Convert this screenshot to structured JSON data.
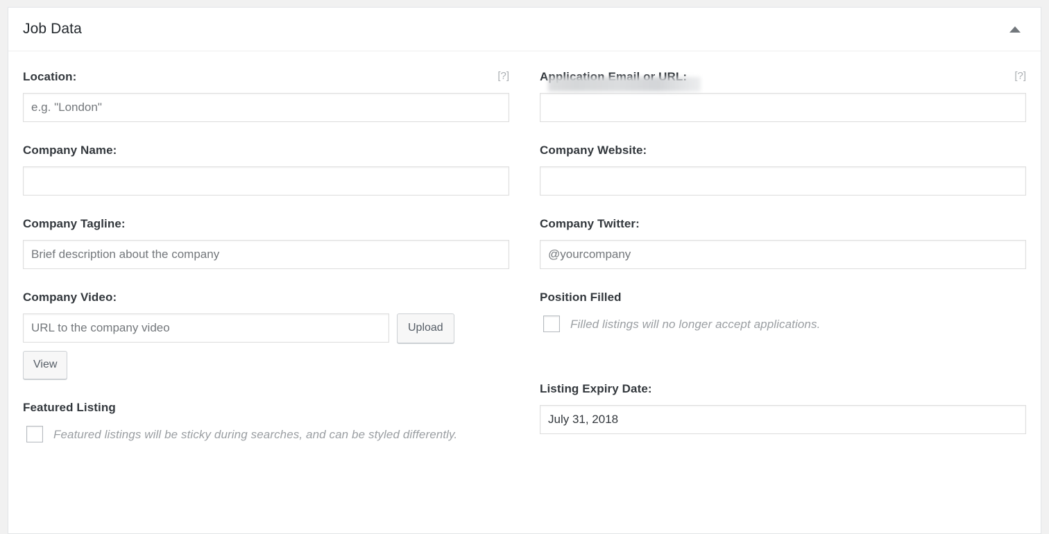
{
  "panel": {
    "title": "Job Data",
    "toggle_icon": "caret-up-icon",
    "toggle_aria_label": "Toggle panel: Job Data"
  },
  "help_tip_label": "[?]",
  "fields": {
    "location": {
      "label": "Location:",
      "placeholder": "e.g. \"London\"",
      "value": "",
      "help": "[?]"
    },
    "application": {
      "label": "Application Email or URL:",
      "placeholder": "",
      "value": "",
      "redacted": true,
      "help": "[?]"
    },
    "company_name": {
      "label": "Company Name:",
      "placeholder": "",
      "value": ""
    },
    "company_website": {
      "label": "Company Website:",
      "placeholder": "",
      "value": ""
    },
    "company_tagline": {
      "label": "Company Tagline:",
      "placeholder": "Brief description about the company",
      "value": ""
    },
    "company_twitter": {
      "label": "Company Twitter:",
      "placeholder": "@yourcompany",
      "value": ""
    },
    "company_video": {
      "label": "Company Video:",
      "placeholder": "URL to the company video",
      "value": "",
      "upload_button": "Upload",
      "view_button": "View"
    },
    "position_filled": {
      "label": "Position Filled",
      "description": "Filled listings will no longer accept applications.",
      "checked": false
    },
    "featured_listing": {
      "label": "Featured Listing",
      "description": "Featured listings will be sticky during searches, and can be styled differently.",
      "checked": false
    },
    "listing_expiry": {
      "label": "Listing Expiry Date:",
      "placeholder": "",
      "value": "July 31, 2018"
    }
  },
  "colors": {
    "page_background": "#f1f1f1",
    "panel_background": "#ffffff",
    "panel_border": "#e2e4e7",
    "label_text": "#32373c",
    "placeholder_text": "#73777b",
    "muted_text": "#9a9ea2",
    "input_border": "#dddddd",
    "button_background": "#f7f7f7",
    "button_border": "#ccd0d4",
    "caret": "#72777c"
  }
}
